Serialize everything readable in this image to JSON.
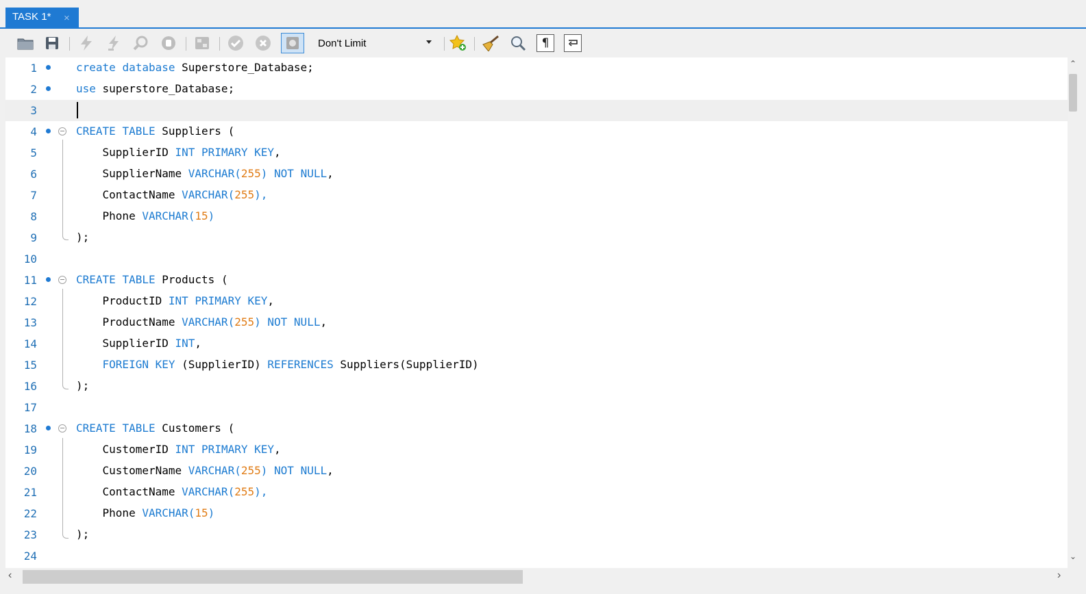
{
  "tab": {
    "title": "TASK 1*",
    "close": "×"
  },
  "toolbar": {
    "limit_value": "Don't Limit",
    "icons": [
      "open-folder-icon",
      "save-icon",
      "execute-icon",
      "execute-current-icon",
      "explain-icon",
      "stop-icon",
      "toggle-output-icon",
      "commit-icon",
      "rollback-icon",
      "autocommit-icon",
      "snippet-add-icon",
      "beautify-icon",
      "find-icon",
      "invisible-chars-icon",
      "word-wrap-icon"
    ]
  },
  "editor": {
    "current_line": 3,
    "lines": [
      {
        "n": "1"
      },
      {
        "n": "2"
      },
      {
        "n": "3"
      },
      {
        "n": "4"
      },
      {
        "n": "5"
      },
      {
        "n": "6"
      },
      {
        "n": "7"
      },
      {
        "n": "8"
      },
      {
        "n": "9"
      },
      {
        "n": "10"
      },
      {
        "n": "11"
      },
      {
        "n": "12"
      },
      {
        "n": "13"
      },
      {
        "n": "14"
      },
      {
        "n": "15"
      },
      {
        "n": "16"
      },
      {
        "n": "17"
      },
      {
        "n": "18"
      },
      {
        "n": "19"
      },
      {
        "n": "20"
      },
      {
        "n": "21"
      },
      {
        "n": "22"
      },
      {
        "n": "23"
      },
      {
        "n": "24"
      }
    ],
    "code": {
      "l1": [
        "create",
        " ",
        "database",
        " Superstore_Database;"
      ],
      "l2": [
        "use",
        " superstore_Database;"
      ],
      "l4": [
        "CREATE",
        " ",
        "TABLE",
        " Suppliers ("
      ],
      "l5": [
        "    SupplierID ",
        "INT",
        " ",
        "PRIMARY",
        " ",
        "KEY",
        ","
      ],
      "l6": [
        "    SupplierName ",
        "VARCHAR",
        "(",
        "255",
        ") ",
        "NOT",
        " ",
        "NULL",
        ","
      ],
      "l7": [
        "    ContactName ",
        "VARCHAR",
        "(",
        "255",
        "),"
      ],
      "l8": [
        "    Phone ",
        "VARCHAR",
        "(",
        "15",
        ")"
      ],
      "l9": [
        ");"
      ],
      "l11": [
        "CREATE",
        " ",
        "TABLE",
        " Products ("
      ],
      "l12": [
        "    ProductID ",
        "INT",
        " ",
        "PRIMARY",
        " ",
        "KEY",
        ","
      ],
      "l13": [
        "    ProductName ",
        "VARCHAR",
        "(",
        "255",
        ") ",
        "NOT",
        " ",
        "NULL",
        ","
      ],
      "l14": [
        "    SupplierID ",
        "INT",
        ","
      ],
      "l15": [
        "    ",
        "FOREIGN",
        " ",
        "KEY",
        " (SupplierID) ",
        "REFERENCES",
        " Suppliers(SupplierID)"
      ],
      "l16": [
        ");"
      ],
      "l18": [
        "CREATE",
        " ",
        "TABLE",
        " Customers ("
      ],
      "l19": [
        "    CustomerID ",
        "INT",
        " ",
        "PRIMARY",
        " ",
        "KEY",
        ","
      ],
      "l20": [
        "    CustomerName ",
        "VARCHAR",
        "(",
        "255",
        ") ",
        "NOT",
        " ",
        "NULL",
        ","
      ],
      "l21": [
        "    ContactName ",
        "VARCHAR",
        "(",
        "255",
        "),"
      ],
      "l22": [
        "    Phone ",
        "VARCHAR",
        "(",
        "15",
        ")"
      ],
      "l23": [
        ");"
      ]
    }
  },
  "colors": {
    "accent": "#1f7ad3",
    "keyword": "#1c7bd1",
    "number": "#e07b14"
  }
}
